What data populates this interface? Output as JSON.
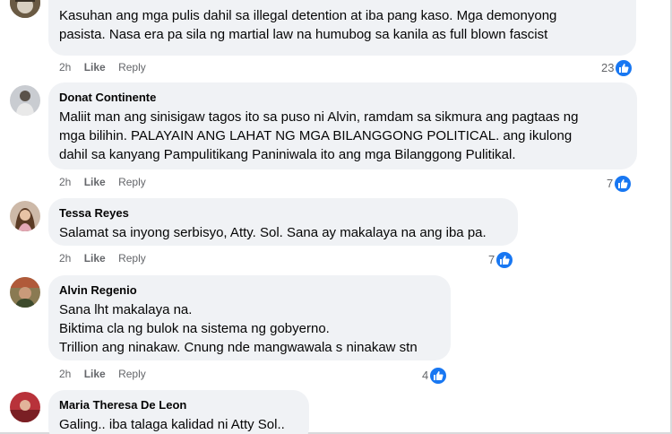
{
  "colors": {
    "bubble": "#f0f2f5",
    "meta_text": "#65676b",
    "like_blue": "#1877f2"
  },
  "comments": [
    {
      "author": "",
      "lines": [
        "Kasuhan ang mga pulis dahil sa illegal detention at iba pang kaso. Mga demonyong",
        "pasista. Nasa era pa sila ng martial law na humubog sa kanila as full blown fascist"
      ],
      "time": "2h",
      "like_label": "Like",
      "reply_label": "Reply",
      "reactions": "23",
      "reaction_icon": "thumbs-up-icon"
    },
    {
      "author": "Donat Continente",
      "lines": [
        "Maliit man ang sinisigaw tagos ito sa puso ni Alvin, ramdam sa sikmura ang pagtaas ng",
        "mga bilihin. PALAYAIN ANG LAHAT NG MGA BILANGGONG POLITICAL. ang ikulong",
        "dahil sa kanyang Pampulitikang Paniniwala ito ang mga Bilanggong Pulitikal."
      ],
      "time": "2h",
      "like_label": "Like",
      "reply_label": "Reply",
      "reactions": "7",
      "reaction_icon": "thumbs-up-icon"
    },
    {
      "author": "Tessa Reyes",
      "lines": [
        "Salamat sa inyong serbisyo, Atty. Sol. Sana ay makalaya na ang iba pa."
      ],
      "time": "2h",
      "like_label": "Like",
      "reply_label": "Reply",
      "reactions": "7",
      "reaction_icon": "thumbs-up-icon"
    },
    {
      "author": "Alvin Regenio",
      "lines": [
        "Sana lht makalaya na.",
        "Biktima cla ng bulok na sistema ng gobyerno.",
        "Trillion ang ninakaw. Cnung nde mangwawala s ninakaw stn"
      ],
      "time": "2h",
      "like_label": "Like",
      "reply_label": "Reply",
      "reactions": "4",
      "reaction_icon": "thumbs-up-icon"
    },
    {
      "author": "Maria Theresa De Leon",
      "lines": [
        "Galing.. iba talaga kalidad ni Atty Sol.."
      ],
      "time": "",
      "like_label": "",
      "reply_label": "",
      "reactions": "",
      "reaction_icon": ""
    }
  ]
}
